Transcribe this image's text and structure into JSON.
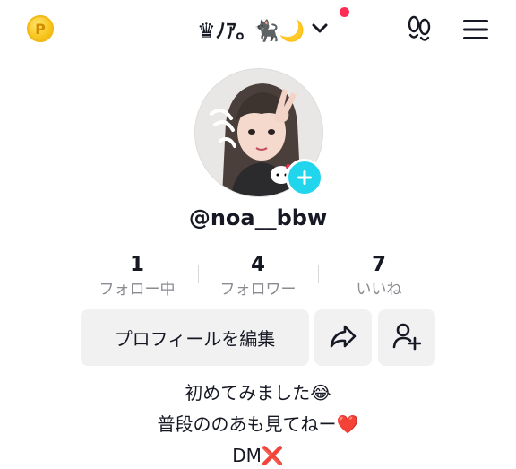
{
  "header": {
    "coin_icon": "coin-icon",
    "title": "♛ﾉｱ｡ 🐈‍⬛🌙",
    "dropdown_icon": "chevron-down-icon",
    "notification_color": "#fe2c55",
    "footprints_icon": "footprints-icon",
    "menu_icon": "hamburger-menu-icon"
  },
  "profile": {
    "username": "@noa__bbw",
    "avatar_icon": "profile-avatar",
    "add_badge_icon": "plus-icon",
    "badge_color": "#20d5ec"
  },
  "stats": [
    {
      "value": "1",
      "label": "フォロー中"
    },
    {
      "value": "4",
      "label": "フォロワー"
    },
    {
      "value": "7",
      "label": "いいね"
    }
  ],
  "actions": {
    "edit_profile_label": "プロフィールを編集",
    "share_icon": "share-arrow-icon",
    "add_friend_icon": "add-friend-icon"
  },
  "bio": {
    "line1": "初めてみました😂",
    "line2": "普段ののあも見てねー❤️",
    "line3": "DM❌"
  }
}
